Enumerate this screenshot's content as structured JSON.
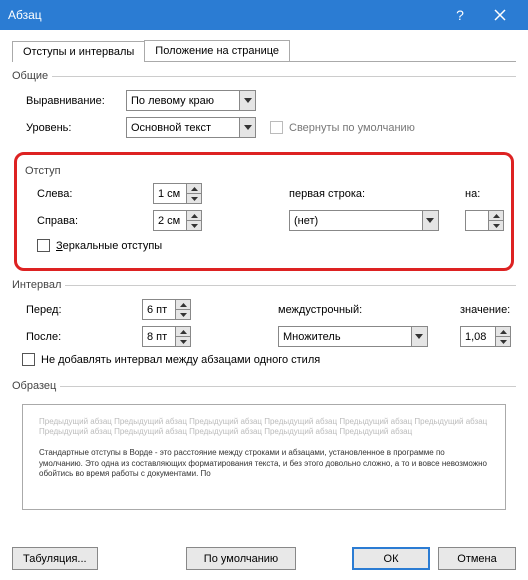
{
  "title": "Абзац",
  "tabs": {
    "t1": "Отступы и интервалы",
    "t2": "Положение на странице"
  },
  "general": {
    "title": "Общие",
    "align_label": "Выравнивание:",
    "align_value": "По левому краю",
    "level_label": "Уровень:",
    "level_value": "Основной текст",
    "collapse_label": "Свернуты по умолчанию"
  },
  "indent": {
    "title": "Отступ",
    "left_label": "Слева:",
    "left_value": "1 см",
    "right_label": "Справа:",
    "right_value": "2 см",
    "first_label": "первая строка:",
    "first_value": "(нет)",
    "by_label": "на:",
    "by_value": "",
    "mirror_label": "Зеркальные отступы"
  },
  "spacing": {
    "title": "Интервал",
    "before_label": "Перед:",
    "before_value": "6 пт",
    "after_label": "После:",
    "after_value": "8 пт",
    "line_label": "междустрочный:",
    "line_value": "Множитель",
    "at_label": "значение:",
    "at_value": "1,08",
    "nosame_label": "Не добавлять интервал между абзацами одного стиля"
  },
  "sample": {
    "title": "Образец",
    "fade": "Предыдущий абзац Предыдущий абзац Предыдущий абзац Предыдущий абзац Предыдущий абзац Предыдущий абзац Предыдущий абзац Предыдущий абзац Предыдущий абзац Предыдущий абзац Предыдущий абзац",
    "text": "Стандартные отступы в Ворде - это расстояние между строками и абзацами, установленное в программе по умолчанию. Это одна из составляющих форматирования текста, и без этого довольно сложно, а то и вовсе невозможно обойтись во время работы с документами. По"
  },
  "buttons": {
    "tabs": "Табуляция...",
    "default": "По умолчанию",
    "ok": "ОК",
    "cancel": "Отмена"
  }
}
